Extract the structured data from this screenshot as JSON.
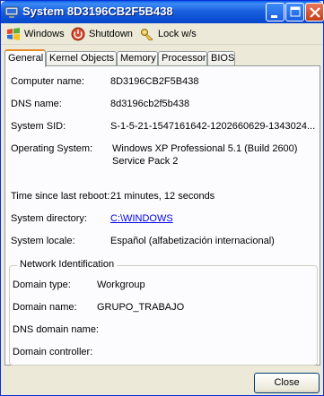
{
  "window": {
    "title": "System 8D3196CB2F5B438"
  },
  "toolbar": {
    "windows_label": "Windows",
    "shutdown_label": "Shutdown",
    "lock_label": "Lock w/s"
  },
  "tabs": [
    {
      "label": "General",
      "active": true
    },
    {
      "label": "Kernel Objects"
    },
    {
      "label": "Memory"
    },
    {
      "label": "Processor"
    },
    {
      "label": "BIOS"
    }
  ],
  "general": {
    "computer_name_label": "Computer name:",
    "computer_name": "8D3196CB2F5B438",
    "dns_name_label": "DNS name:",
    "dns_name": "8d3196cb2f5b438",
    "system_sid_label": "System SID:",
    "system_sid": "S-1-5-21-1547161642-1202660629-1343024...",
    "os_label": "Operating System:",
    "os_line1": "Windows XP Professional 5.1 (Build 2600)",
    "os_line2": "Service Pack 2",
    "reboot_label": "Time since last reboot:",
    "reboot_value": "21 minutes, 12 seconds",
    "sysdir_label": "System directory:",
    "sysdir_value": "C:\\WINDOWS",
    "locale_label": "System locale:",
    "locale_value": "Español (alfabetización internacional)"
  },
  "network": {
    "title": "Network Identification",
    "domain_type_label": "Domain type:",
    "domain_type": "Workgroup",
    "domain_name_label": "Domain name:",
    "domain_name": "GRUPO_TRABAJO",
    "dns_domain_label": "DNS domain name:",
    "dns_domain": "",
    "domain_controller_label": "Domain controller:",
    "domain_controller": ""
  },
  "buttons": {
    "close": "Close"
  },
  "colors": {
    "title_bar": "#0a5fe8",
    "link": "#0000ee",
    "active_tab_accent": "#e68b2c"
  }
}
